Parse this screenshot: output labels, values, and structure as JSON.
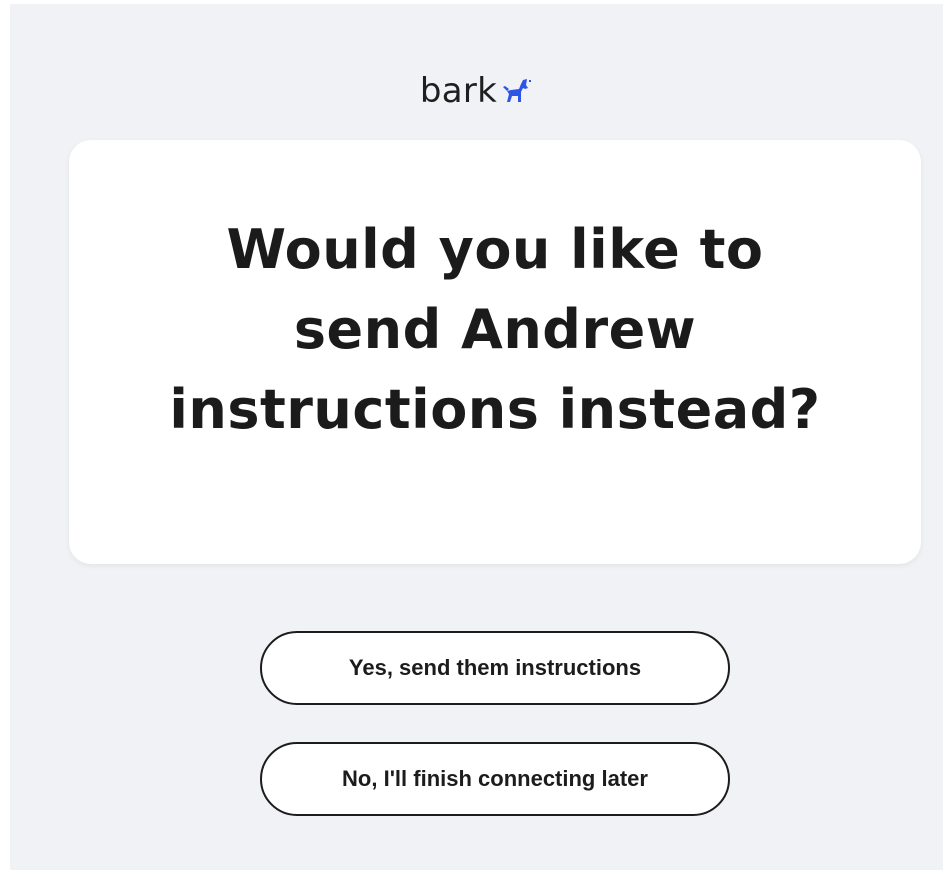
{
  "logo": {
    "text": "bark",
    "icon": "dog-icon",
    "icon_color": "#2f55e8"
  },
  "dialog": {
    "title": "Would you like to send Andrew instructions instead?"
  },
  "actions": {
    "yes_label": "Yes, send them instructions",
    "no_label": "No, I'll finish connecting later"
  },
  "colors": {
    "background": "#f1f2f5",
    "card": "#ffffff",
    "text": "#1b1b1b",
    "brand": "#2f55e8"
  }
}
